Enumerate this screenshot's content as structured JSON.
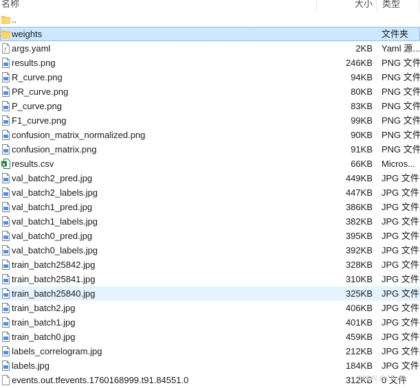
{
  "header": {
    "name": "名称",
    "size": "大小",
    "type": "类型"
  },
  "rows": [
    {
      "name": "..",
      "size": "",
      "type": "",
      "icon": "folder-icon"
    },
    {
      "name": "weights",
      "size": "",
      "type": "文件夹",
      "icon": "folder-icon",
      "state": "selected"
    },
    {
      "name": "args.yaml",
      "size": "2KB",
      "type": "Yaml 源...",
      "icon": "yaml-file-icon"
    },
    {
      "name": "results.png",
      "size": "246KB",
      "type": "PNG 文件",
      "icon": "image-file-icon"
    },
    {
      "name": "R_curve.png",
      "size": "94KB",
      "type": "PNG 文件",
      "icon": "image-file-icon"
    },
    {
      "name": "PR_curve.png",
      "size": "80KB",
      "type": "PNG 文件",
      "icon": "image-file-icon"
    },
    {
      "name": "P_curve.png",
      "size": "83KB",
      "type": "PNG 文件",
      "icon": "image-file-icon"
    },
    {
      "name": "F1_curve.png",
      "size": "99KB",
      "type": "PNG 文件",
      "icon": "image-file-icon"
    },
    {
      "name": "confusion_matrix_normalized.png",
      "size": "90KB",
      "type": "PNG 文件",
      "icon": "image-file-icon"
    },
    {
      "name": "confusion_matrix.png",
      "size": "91KB",
      "type": "PNG 文件",
      "icon": "image-file-icon"
    },
    {
      "name": "results.csv",
      "size": "66KB",
      "type": "Micros...",
      "icon": "excel-file-icon"
    },
    {
      "name": "val_batch2_pred.jpg",
      "size": "449KB",
      "type": "JPG 文件",
      "icon": "image-file-icon"
    },
    {
      "name": "val_batch2_labels.jpg",
      "size": "447KB",
      "type": "JPG 文件",
      "icon": "image-file-icon"
    },
    {
      "name": "val_batch1_pred.jpg",
      "size": "386KB",
      "type": "JPG 文件",
      "icon": "image-file-icon"
    },
    {
      "name": "val_batch1_labels.jpg",
      "size": "382KB",
      "type": "JPG 文件",
      "icon": "image-file-icon"
    },
    {
      "name": "val_batch0_pred.jpg",
      "size": "395KB",
      "type": "JPG 文件",
      "icon": "image-file-icon"
    },
    {
      "name": "val_batch0_labels.jpg",
      "size": "392KB",
      "type": "JPG 文件",
      "icon": "image-file-icon"
    },
    {
      "name": "train_batch25842.jpg",
      "size": "328KB",
      "type": "JPG 文件",
      "icon": "image-file-icon"
    },
    {
      "name": "train_batch25841.jpg",
      "size": "310KB",
      "type": "JPG 文件",
      "icon": "image-file-icon"
    },
    {
      "name": "train_batch25840.jpg",
      "size": "325KB",
      "type": "JPG 文件",
      "icon": "image-file-icon",
      "state": "hover"
    },
    {
      "name": "train_batch2.jpg",
      "size": "406KB",
      "type": "JPG 文件",
      "icon": "image-file-icon"
    },
    {
      "name": "train_batch1.jpg",
      "size": "401KB",
      "type": "JPG 文件",
      "icon": "image-file-icon"
    },
    {
      "name": "train_batch0.jpg",
      "size": "459KB",
      "type": "JPG 文件",
      "icon": "image-file-icon"
    },
    {
      "name": "labels_correlogram.jpg",
      "size": "212KB",
      "type": "JPG 文件",
      "icon": "image-file-icon"
    },
    {
      "name": "labels.jpg",
      "size": "184KB",
      "type": "JPG 文件",
      "icon": "image-file-icon"
    },
    {
      "name": "events.out.tfevents.1760168999.t91.84551.0",
      "size": "312KB",
      "type": "0 文件",
      "icon": "blank-file-icon"
    }
  ],
  "watermark": "CSDN @Cherry",
  "colors": {
    "selected_bg": "#cce8ff",
    "hover_bg": "#e5f3ff",
    "folder": "#f6c84c",
    "excel": "#1d7a3e"
  }
}
